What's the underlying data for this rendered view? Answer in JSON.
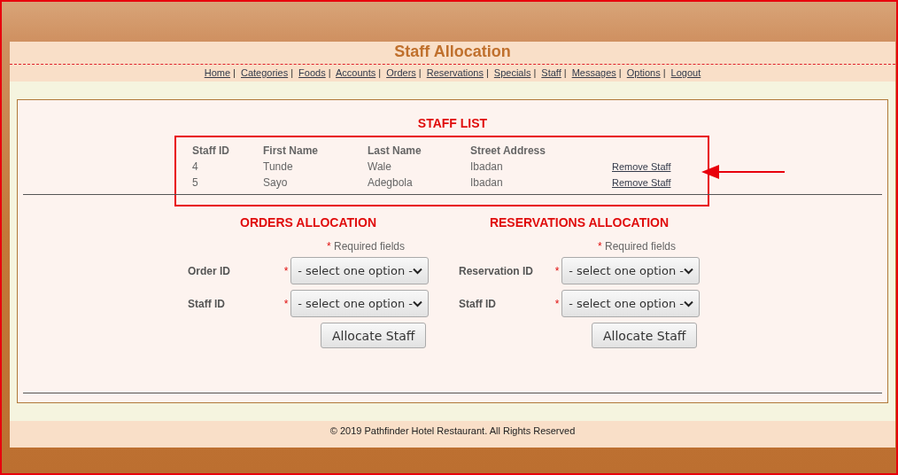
{
  "title": "Staff Allocation",
  "nav_separator": "|",
  "nav": [
    "Home",
    "Categories",
    "Foods",
    "Accounts",
    "Orders",
    "Reservations",
    "Specials",
    "Staff",
    "Messages",
    "Options",
    "Logout"
  ],
  "staff_list": {
    "heading": "STAFF LIST",
    "columns": [
      "Staff ID",
      "First Name",
      "Last Name",
      "Street Address"
    ],
    "rows": [
      {
        "cells": [
          "4",
          "Tunde",
          "Wale",
          "Ibadan"
        ],
        "action": "Remove Staff"
      },
      {
        "cells": [
          "5",
          "Sayo",
          "Adegbola",
          "Ibadan"
        ],
        "action": "Remove Staff"
      }
    ]
  },
  "forms": [
    {
      "heading": "ORDERS ALLOCATION",
      "required_mark": "*",
      "required_note": "Required fields",
      "fields": [
        {
          "label": "Order ID",
          "required": true,
          "value": "- select one option -"
        },
        {
          "label": "Staff ID",
          "required": true,
          "value": "- select one option -"
        }
      ],
      "button": "Allocate Staff"
    },
    {
      "heading": "RESERVATIONS ALLOCATION",
      "required_mark": "*",
      "required_note": "Required fields",
      "fields": [
        {
          "label": "Reservation ID",
          "required": true,
          "value": "- select one option -"
        },
        {
          "label": "Staff ID",
          "required": true,
          "value": "- select one option -"
        }
      ],
      "button": "Allocate Staff"
    }
  ],
  "footer": "© 2019 Pathfinder Hotel Restaurant. All Rights Reserved"
}
